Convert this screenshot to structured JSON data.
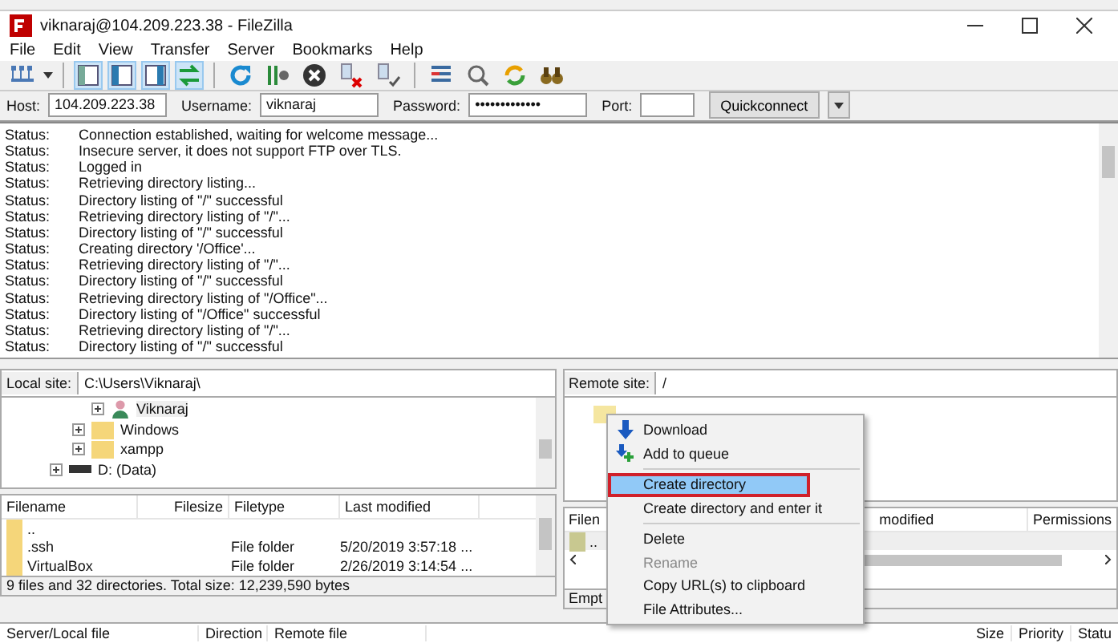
{
  "window": {
    "title": "viknaraj@104.209.223.38 - FileZilla"
  },
  "menu": [
    "File",
    "Edit",
    "View",
    "Transfer",
    "Server",
    "Bookmarks",
    "Help"
  ],
  "toolbar": {
    "toggles": [
      {
        "on": true
      },
      {
        "on": true
      },
      {
        "on": true
      },
      {
        "on": true
      }
    ]
  },
  "quickconnect": {
    "host_label": "Host:",
    "host": "104.209.223.38",
    "username_label": "Username:",
    "username": "viknaraj",
    "password_label": "Password:",
    "password": "•••••••••••••",
    "port_label": "Port:",
    "button": "Quickconnect"
  },
  "log": [
    {
      "label": "Status:",
      "message": "Connection established, waiting for welcome message..."
    },
    {
      "label": "Status:",
      "message": "Insecure server, it does not support FTP over TLS."
    },
    {
      "label": "Status:",
      "message": "Logged in"
    },
    {
      "label": "Status:",
      "message": "Retrieving directory listing..."
    },
    {
      "label": "Status:",
      "message": "Directory listing of \"/\" successful"
    },
    {
      "label": "Status:",
      "message": "Retrieving directory listing of \"/\"..."
    },
    {
      "label": "Status:",
      "message": "Directory listing of \"/\" successful"
    },
    {
      "label": "Status:",
      "message": "Creating directory '/Office'..."
    },
    {
      "label": "Status:",
      "message": "Retrieving directory listing of \"/\"..."
    },
    {
      "label": "Status:",
      "message": "Directory listing of \"/\" successful"
    },
    {
      "label": "Status:",
      "message": "Retrieving directory listing of \"/Office\"..."
    },
    {
      "label": "Status:",
      "message": "Directory listing of \"/Office\" successful"
    },
    {
      "label": "Status:",
      "message": "Retrieving directory listing of \"/\"..."
    },
    {
      "label": "Status:",
      "message": "Directory listing of \"/\" successful"
    }
  ],
  "local": {
    "site_label": "Local site:",
    "path": "C:\\Users\\Viknaraj\\",
    "tree": [
      {
        "children": [
          {
            "label": "Viknaraj",
            "kind": "user"
          },
          {
            "label": "Windows",
            "kind": "folder"
          },
          {
            "label": "xampp",
            "kind": "folder"
          }
        ]
      },
      {
        "label": "D: (Data)",
        "kind": "drive"
      }
    ],
    "columns": [
      "Filename",
      "Filesize",
      "Filetype",
      "Last modified"
    ],
    "rows": [
      {
        "name": "..",
        "type": "",
        "modified": ""
      },
      {
        "name": ".ssh",
        "type": "File folder",
        "modified": "5/20/2019 3:57:18 ..."
      },
      {
        "name": "VirtualBox",
        "type": "File folder",
        "modified": "2/26/2019 3:14:54 ..."
      }
    ],
    "status": "9 files and 32 directories. Total size: 12,239,590 bytes"
  },
  "remote": {
    "site_label": "Remote site:",
    "path": "/",
    "columns": [
      "Filen",
      "modified",
      "Permissions"
    ],
    "rows": [
      {
        "name": ".."
      }
    ],
    "status": "Empt"
  },
  "context_menu": [
    {
      "kind": "download",
      "label": "Download",
      "selected": false,
      "disabled": false
    },
    {
      "kind": "enqueue",
      "label": "Add to queue",
      "selected": false,
      "disabled": false
    },
    {
      "kind": "separator"
    },
    {
      "kind": "item",
      "label": "Create directory",
      "selected": true,
      "disabled": false
    },
    {
      "kind": "item",
      "label": "Create directory and enter it",
      "selected": false,
      "disabled": false
    },
    {
      "kind": "separator"
    },
    {
      "kind": "item",
      "label": "Delete",
      "selected": false,
      "disabled": false
    },
    {
      "kind": "item",
      "label": "Rename",
      "selected": false,
      "disabled": true
    },
    {
      "kind": "item",
      "label": "Copy URL(s) to clipboard",
      "selected": false,
      "disabled": false
    },
    {
      "kind": "item",
      "label": "File Attributes...",
      "selected": false,
      "disabled": false
    }
  ],
  "queue": {
    "columns": [
      "Server/Local file",
      "Direction",
      "Remote file",
      "Size",
      "Priority",
      "Statu"
    ]
  }
}
